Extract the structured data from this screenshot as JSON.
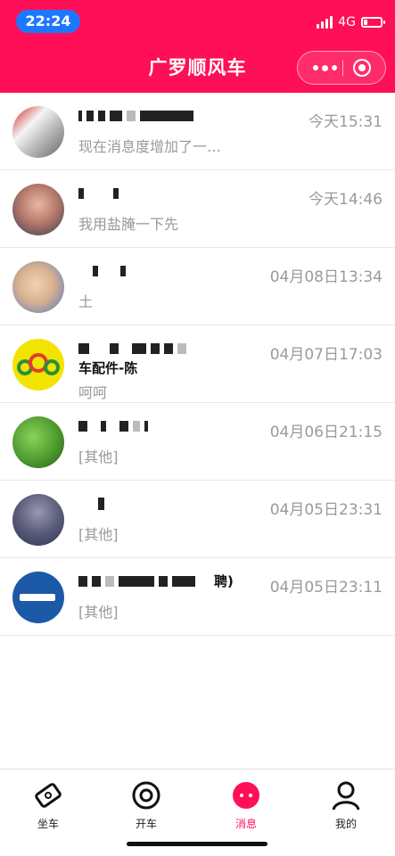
{
  "status_bar": {
    "time": "22:24",
    "network": "4G",
    "battery_level": 0.2
  },
  "header": {
    "title": "广罗顺风车"
  },
  "colors": {
    "brand": "#ff0f57",
    "time_pill": "#1e78ff",
    "muted_text": "#999999"
  },
  "messages": [
    {
      "name": "",
      "time": "今天15:31",
      "preview": "现在消息度增加了一…"
    },
    {
      "name": "",
      "time": "今天14:46",
      "preview": "我用盐腌一下先"
    },
    {
      "name": "",
      "time": "04月08日13:34",
      "preview": "土"
    },
    {
      "name": "车配件-陈",
      "time": "04月07日17:03",
      "preview": "呵呵"
    },
    {
      "name": "",
      "time": "04月06日21:15",
      "preview": "[其他]"
    },
    {
      "name": "",
      "time": "04月05日23:31",
      "preview": "[其他]"
    },
    {
      "name": "聘)",
      "time": "04月05日23:11",
      "preview": "[其他]"
    }
  ],
  "nav": {
    "items": [
      {
        "label": "坐车",
        "icon": "ticket-icon"
      },
      {
        "label": "开车",
        "icon": "steering-wheel-icon"
      },
      {
        "label": "消息",
        "icon": "message-bubble-icon"
      },
      {
        "label": "我的",
        "icon": "user-icon"
      }
    ]
  }
}
